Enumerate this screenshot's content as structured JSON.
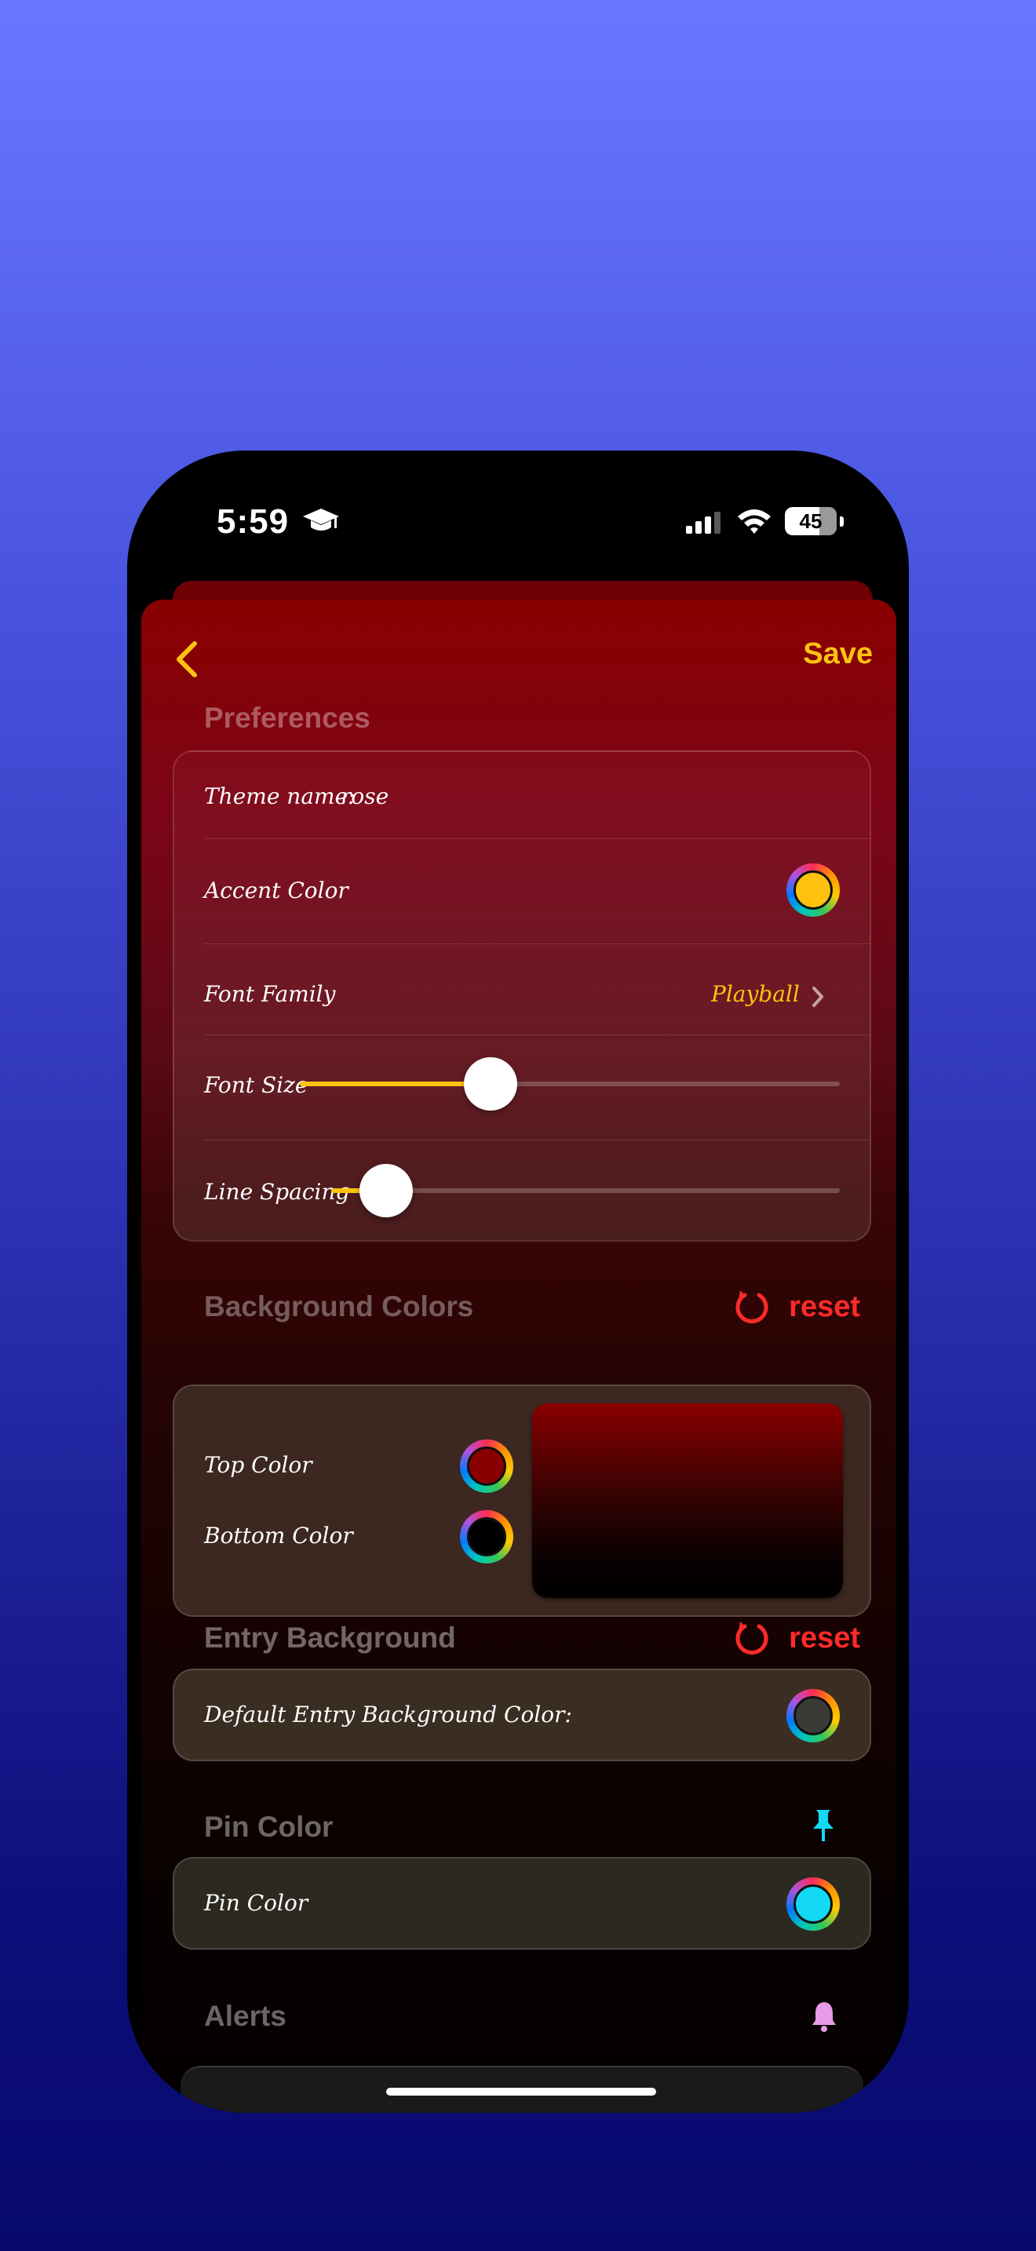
{
  "status_bar": {
    "time": "5:59",
    "battery": "45"
  },
  "nav": {
    "save_label": "Save"
  },
  "preferences": {
    "title": "Preferences",
    "theme_name_label": "Theme name:",
    "theme_name_value": "rose",
    "accent_label": "Accent Color",
    "accent_color": "#ffc30f",
    "font_family_label": "Font Family",
    "font_family_value": "Playball",
    "font_size_label": "Font Size",
    "font_size_fraction": 0.35,
    "line_spacing_label": "Line Spacing",
    "line_spacing_fraction": 0.11
  },
  "background_colors": {
    "title": "Background Colors",
    "reset_label": "reset",
    "top_label": "Top Color",
    "top_color": "#8a0000",
    "bottom_label": "Bottom Color",
    "bottom_color": "#000000"
  },
  "entry_background": {
    "title": "Entry Background",
    "reset_label": "reset",
    "default_label": "Default Entry Background Color:",
    "color": "#3a3a36"
  },
  "pin_color": {
    "title": "Pin Color",
    "label": "Pin Color",
    "color": "#13d9f5"
  },
  "alerts": {
    "title": "Alerts"
  },
  "colors": {
    "accent": "#ffc30f",
    "reset": "#ff2a2a",
    "section_title": "rgba(255,255,255,0.4)"
  },
  "icons": [
    "graduation-cap-icon",
    "signal-icon",
    "wifi-icon",
    "battery-icon",
    "chevron-left-icon",
    "chevron-right-icon",
    "reset-icon",
    "pin-icon",
    "bell-icon"
  ]
}
